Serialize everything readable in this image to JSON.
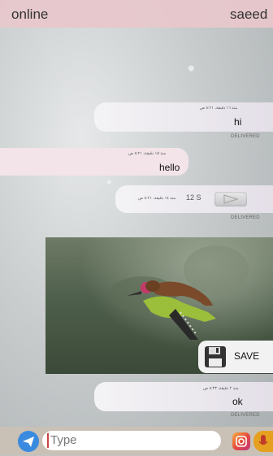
{
  "status": {
    "left": "online",
    "right": "saeed"
  },
  "messages": [
    {
      "time": "منذ ١٦ دقيقة، ٨:٢١ ص",
      "text": "hi",
      "status": "DELIVERED"
    },
    {
      "time": "منذ ١٥ دقيقة، ٨:٢١ ص",
      "text": "hello"
    },
    {
      "time": "منذ ١٤ دقيقة، ٨:٢١ ص",
      "duration": "12 S",
      "status": "DELIVERED"
    },
    {
      "time": "منذ ٢ دقيقة، ٨:٣٣ ص",
      "text": "ok",
      "status": "DELIVERED"
    }
  ],
  "photo": {
    "save_label": "SAVE"
  },
  "composer": {
    "placeholder": "Type"
  },
  "colors": {
    "topbar": "#e8c8cc",
    "in_bubble": "#f2e4e8",
    "out_bubble": "#ebe7ee",
    "composer": "#c9c0b6",
    "send": "#3a8be0"
  },
  "icons": [
    "send-icon",
    "play-icon",
    "floppy-disk-icon",
    "instagram-icon",
    "microphone-icon"
  ]
}
